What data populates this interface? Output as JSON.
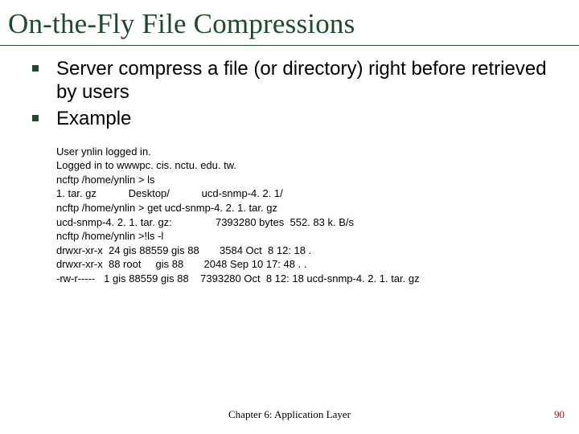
{
  "title": "On-the-Fly File Compressions",
  "bullets": [
    "Server compress a file (or directory) right before retrieved by users",
    "Example"
  ],
  "terminal": "User ynlin logged in.\nLogged in to wwwpc. cis. nctu. edu. tw.\nncftp /home/ynlin > ls\n1. tar. gz           Desktop/           ucd-snmp-4. 2. 1/\nncftp /home/ynlin > get ucd-snmp-4. 2. 1. tar. gz\nucd-snmp-4. 2. 1. tar. gz:               7393280 bytes  552. 83 k. B/s\nncftp /home/ynlin >!ls -l\ndrwxr-xr-x  24 gis 88559 gis 88       3584 Oct  8 12: 18 .\ndrwxr-xr-x  88 root     gis 88       2048 Sep 10 17: 48 . .\n-rw-r-----   1 gis 88559 gis 88    7393280 Oct  8 12: 18 ucd-snmp-4. 2. 1. tar. gz",
  "footer_center": "Chapter 6: Application Layer",
  "footer_right": "90"
}
